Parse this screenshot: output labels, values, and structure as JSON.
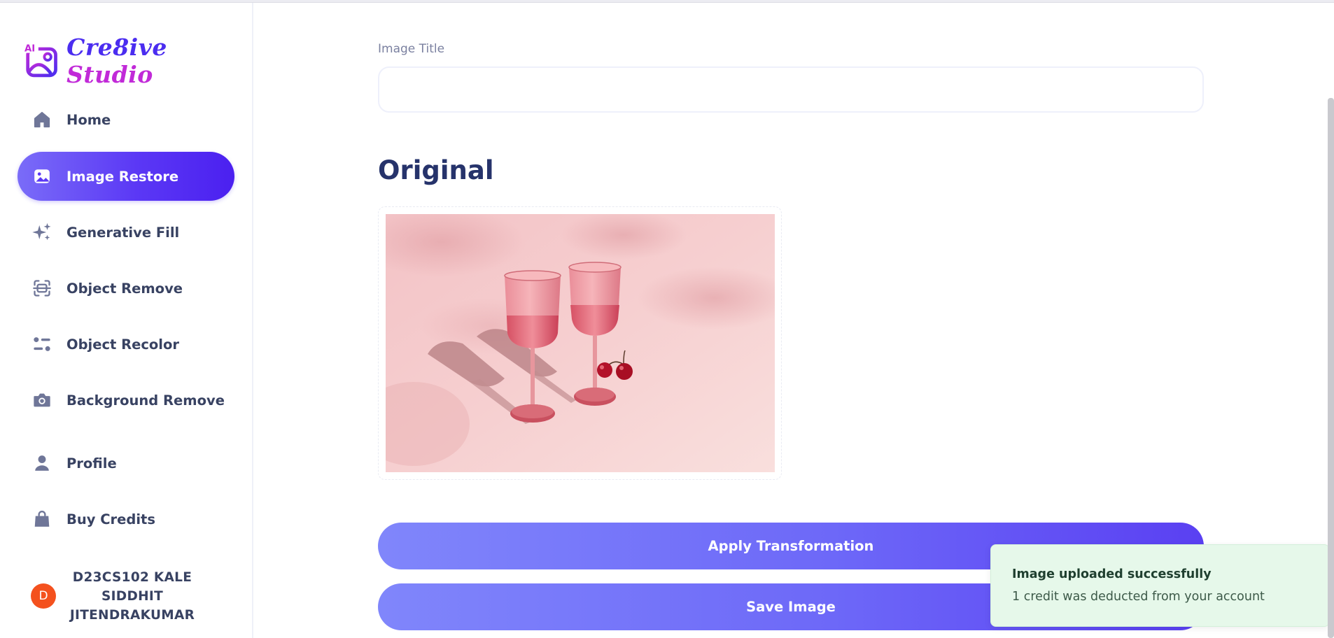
{
  "app": {
    "logo_text_part1": "Cre8ive",
    "logo_text_part2": "Studio",
    "logo_badge": "AI"
  },
  "sidebar": {
    "items": [
      {
        "label": "Home",
        "icon": "home-icon"
      },
      {
        "label": "Image Restore",
        "icon": "image-icon",
        "active": true
      },
      {
        "label": "Generative Fill",
        "icon": "sparkles-icon"
      },
      {
        "label": "Object Remove",
        "icon": "scan-icon"
      },
      {
        "label": "Object Recolor",
        "icon": "filter-icon"
      },
      {
        "label": "Background Remove",
        "icon": "camera-icon"
      },
      {
        "label": "Profile",
        "icon": "user-icon"
      },
      {
        "label": "Buy Credits",
        "icon": "shopping-bag-icon"
      }
    ],
    "user": {
      "avatar_letter": "D",
      "name": "D23CS102 KALE SIDDHIT JITENDRAKUMAR"
    }
  },
  "form": {
    "title_label": "Image Title",
    "title_value": "",
    "section_title": "Original"
  },
  "actions": {
    "apply_label": "Apply Transformation",
    "save_label": "Save Image"
  },
  "toast": {
    "title": "Image uploaded successfully",
    "description": "1 credit was deducted from your account"
  },
  "colors": {
    "accent": "#5b38f5",
    "text": "#384262",
    "heading": "#26336b",
    "toast_bg": "#e6f8ea",
    "avatar": "#f4511e"
  }
}
